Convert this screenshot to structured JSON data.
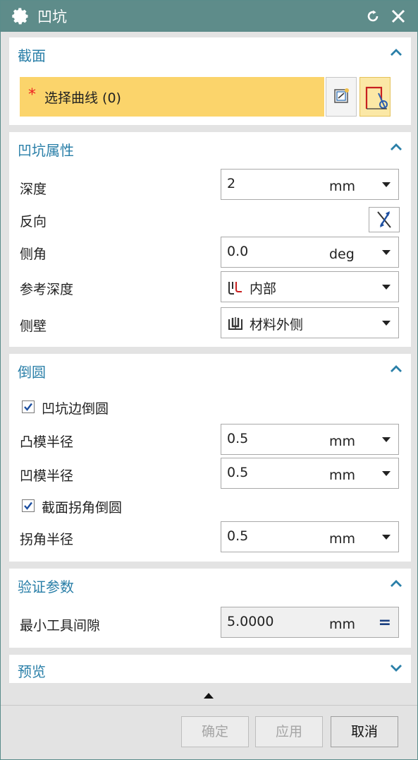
{
  "window": {
    "title": "凹坑"
  },
  "section": {
    "title": "截面",
    "select_curve": {
      "required_mark": "*",
      "label": "选择曲线 (0)"
    }
  },
  "dimple_props": {
    "title": "凹坑属性",
    "depth": {
      "label": "深度",
      "value": "2",
      "unit": "mm"
    },
    "reverse": {
      "label": "反向"
    },
    "side_angle": {
      "label": "侧角",
      "value": "0.0",
      "unit": "deg"
    },
    "ref_depth": {
      "label": "参考深度",
      "value": "内部"
    },
    "side_wall": {
      "label": "侧壁",
      "value": "材料外侧"
    }
  },
  "rounding": {
    "title": "倒圆",
    "dimple_edge_round": {
      "label": "凹坑边倒圆",
      "checked": true
    },
    "punch_radius": {
      "label": "凸模半径",
      "value": "0.5",
      "unit": "mm"
    },
    "die_radius": {
      "label": "凹模半径",
      "value": "0.5",
      "unit": "mm"
    },
    "section_corner_round": {
      "label": "截面拐角倒圆",
      "checked": true
    },
    "corner_radius": {
      "label": "拐角半径",
      "value": "0.5",
      "unit": "mm"
    }
  },
  "validate": {
    "title": "验证参数",
    "min_tool_clearance": {
      "label": "最小工具间隙",
      "value": "5.0000",
      "unit": "mm",
      "symbol": "="
    }
  },
  "preview": {
    "title": "预览"
  },
  "buttons": {
    "ok": "确定",
    "apply": "应用",
    "cancel": "取消"
  },
  "colors": {
    "titlebar": "#5e8c8a",
    "section_title": "#2a7fa8",
    "selection": "#fbd46b"
  }
}
